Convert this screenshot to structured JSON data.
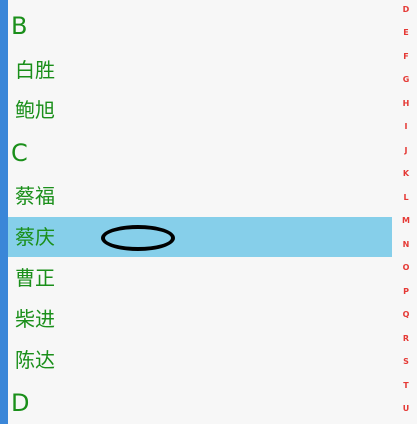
{
  "contacts": {
    "sections": [
      {
        "header": "B",
        "names": [
          "白胜",
          "鲍旭"
        ]
      },
      {
        "header": "C",
        "names": [
          "蔡福",
          "蔡庆",
          "曹正",
          "柴进",
          "陈达"
        ]
      },
      {
        "header": "D",
        "names": []
      }
    ],
    "selected_name": "蔡庆"
  },
  "index_bar": {
    "letters": [
      "D",
      "E",
      "F",
      "G",
      "H",
      "I",
      "J",
      "K",
      "L",
      "M",
      "N",
      "O",
      "P",
      "Q",
      "R",
      "S",
      "T",
      "U"
    ]
  },
  "colors": {
    "name_text": "#1a8f1a",
    "selected_row": "#86cfea",
    "index_letter": "#e53935",
    "left_strip": "#3a86d8"
  }
}
